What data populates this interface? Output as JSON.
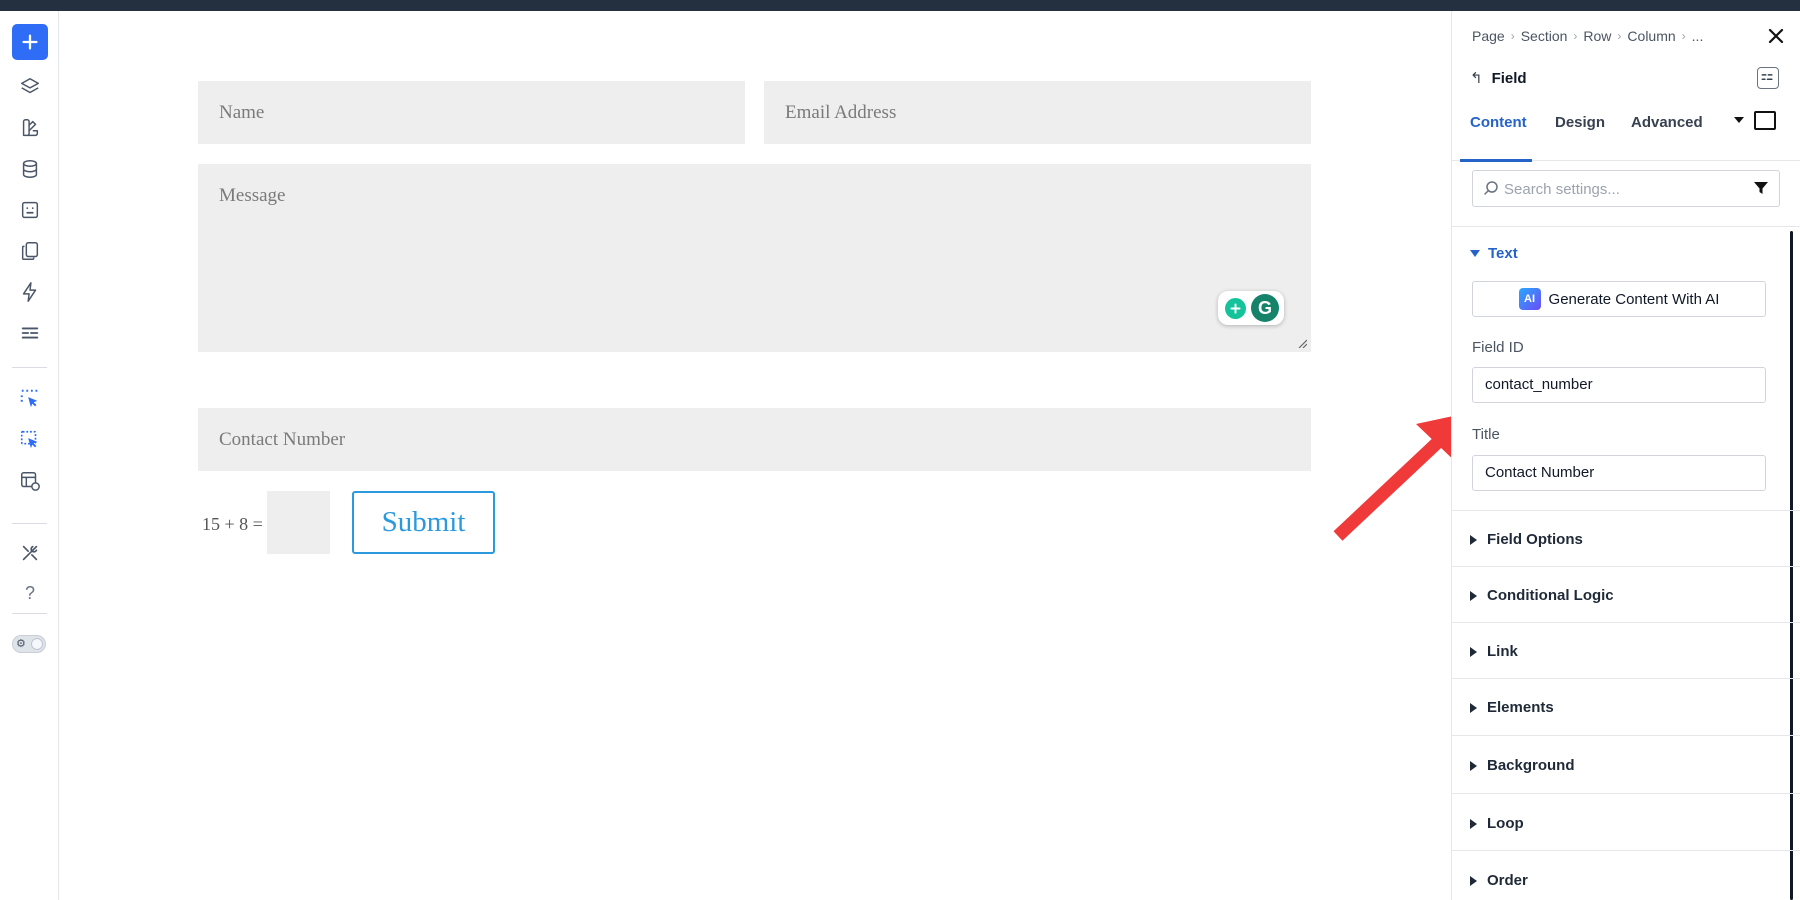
{
  "left_toolbar": {
    "items": [
      {
        "icon": "plus-icon"
      },
      {
        "icon": "layers-icon"
      },
      {
        "icon": "palette-icon"
      },
      {
        "icon": "database-icon"
      },
      {
        "icon": "template-icon"
      },
      {
        "icon": "pages-icon"
      },
      {
        "icon": "lightning-icon"
      },
      {
        "icon": "rows-icon"
      },
      {
        "icon": "select-parent-icon"
      },
      {
        "icon": "select-child-icon"
      },
      {
        "icon": "layout-preview-icon"
      },
      {
        "icon": "tools-icon"
      },
      {
        "icon": "help-icon"
      }
    ],
    "help_glyph": "?",
    "toggle_glyph": "⚙"
  },
  "form": {
    "name_placeholder": "Name",
    "email_placeholder": "Email Address",
    "message_placeholder": "Message",
    "contact_placeholder": "Contact Number",
    "captcha_label": "15 + 8 =",
    "submit_label": "Submit",
    "grammarly_letter": "G"
  },
  "panel": {
    "breadcrumb": [
      "Page",
      "Section",
      "Row",
      "Column",
      "..."
    ],
    "element_title": "Field",
    "tabs": [
      "Content",
      "Design",
      "Advanced"
    ],
    "search_placeholder": "Search settings...",
    "open_section": "Text",
    "ai_badge": "AI",
    "generate_label": "Generate Content With AI",
    "field_id_label": "Field ID",
    "field_id_value": "contact_number",
    "title_label": "Title",
    "title_value": "Contact Number",
    "sections": [
      "Field Options",
      "Conditional Logic",
      "Link",
      "Elements",
      "Background",
      "Loop",
      "Order"
    ]
  },
  "colors": {
    "accent": "#2563c9",
    "add_button": "#2f6df6",
    "submit": "#2b99de",
    "annotation_arrow": "#f03a3a",
    "field_bg": "#eeeeee"
  }
}
